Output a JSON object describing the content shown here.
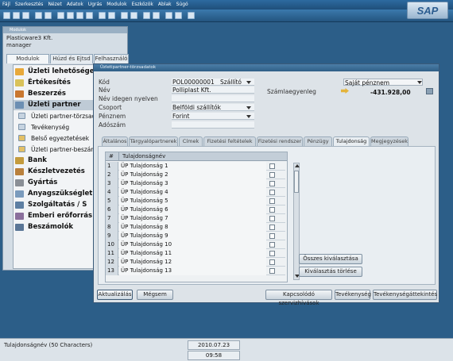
{
  "menubar": [
    "Fájl",
    "Szerkesztés",
    "Nézet",
    "Adatok",
    "Ugrás",
    "Modulok",
    "Eszközök",
    "Ablak",
    "Súgó"
  ],
  "logo": "SAP",
  "module_window": {
    "title": "Modulok",
    "company": "Plasticware3 Kft.",
    "user": "manager",
    "tabs": [
      "Modulok",
      "Húzd és Ejtsd",
      "Felhasználó"
    ],
    "items": [
      {
        "label": "Üzleti lehetőségek",
        "sub": false
      },
      {
        "label": "Értékesítés",
        "sub": false
      },
      {
        "label": "Beszerzés",
        "sub": false
      },
      {
        "label": "Üzleti partner",
        "sub": false
      },
      {
        "label": "Üzleti partner-törzsadatok",
        "sub": true
      },
      {
        "label": "Tevékenység",
        "sub": true
      },
      {
        "label": "Belső egyeztetések",
        "sub": true
      },
      {
        "label": "Üzleti partner-beszámolók",
        "sub": true
      },
      {
        "label": "Bank",
        "sub": false
      },
      {
        "label": "Készletvezetés",
        "sub": false
      },
      {
        "label": "Gyártás",
        "sub": false
      },
      {
        "label": "Anyagszükséglet",
        "sub": false
      },
      {
        "label": "Szolgáltatás / S",
        "sub": false
      },
      {
        "label": "Emberi erőforrás",
        "sub": false
      },
      {
        "label": "Beszámolók",
        "sub": false
      }
    ]
  },
  "bp_window": {
    "title": "Üzletipartner-törzsadatok",
    "fields": {
      "kod_label": "Kód",
      "kod_value": "POL00000001",
      "type_value": "Szállító",
      "nev_label": "Név",
      "nev_value": "Polliplast Kft.",
      "foreign_label": "Név idegen nyelven",
      "csoport_label": "Csoport",
      "csoport_value": "Belföldi szállítók",
      "penznem_label": "Pénznem",
      "penznem_value": "Forint",
      "adoszam_label": "Adószám",
      "currency_select": "Saját pénznem",
      "balance_label": "Számlaegyenleg",
      "balance_value": "-431.928,00"
    },
    "tabs": [
      "Általános",
      "Tárgyalópartnerek",
      "Címek",
      "Fizetési feltételek",
      "Fizetési rendszer",
      "Pénzügy",
      "Tulajdonság",
      "Megjegyzések"
    ],
    "grid": {
      "col_num": "#",
      "col_name": "Tulajdonságnév",
      "rows": [
        "ÜP Tulajdonság 1",
        "ÜP Tulajdonság 2",
        "ÜP Tulajdonság 3",
        "ÜP Tulajdonság 4",
        "ÜP Tulajdonság 5",
        "ÜP Tulajdonság 6",
        "ÜP Tulajdonság 7",
        "ÜP Tulajdonság 8",
        "ÜP Tulajdonság 9",
        "ÜP Tulajdonság 10",
        "ÜP Tulajdonság 11",
        "ÜP Tulajdonság 12",
        "ÜP Tulajdonság 13"
      ]
    },
    "buttons": {
      "select_all": "Összes kiválasztása",
      "clear_selection": "Kiválasztás törlése",
      "update": "Aktualizálás",
      "cancel": "Mégsem",
      "contact_service": "Kapcsolódó szervizhívások",
      "activity": "Tevékenység",
      "activity_overview": "Tevékenységáttekintés"
    }
  },
  "status": {
    "field_info": "Tulajdonságnév (50 Characters)",
    "date": "2010.07.23",
    "time": "09:58"
  },
  "colors": {
    "desk": "#2c5e88",
    "titlebar": "#2f5f86",
    "accent_sap": "#2b5c8f"
  }
}
